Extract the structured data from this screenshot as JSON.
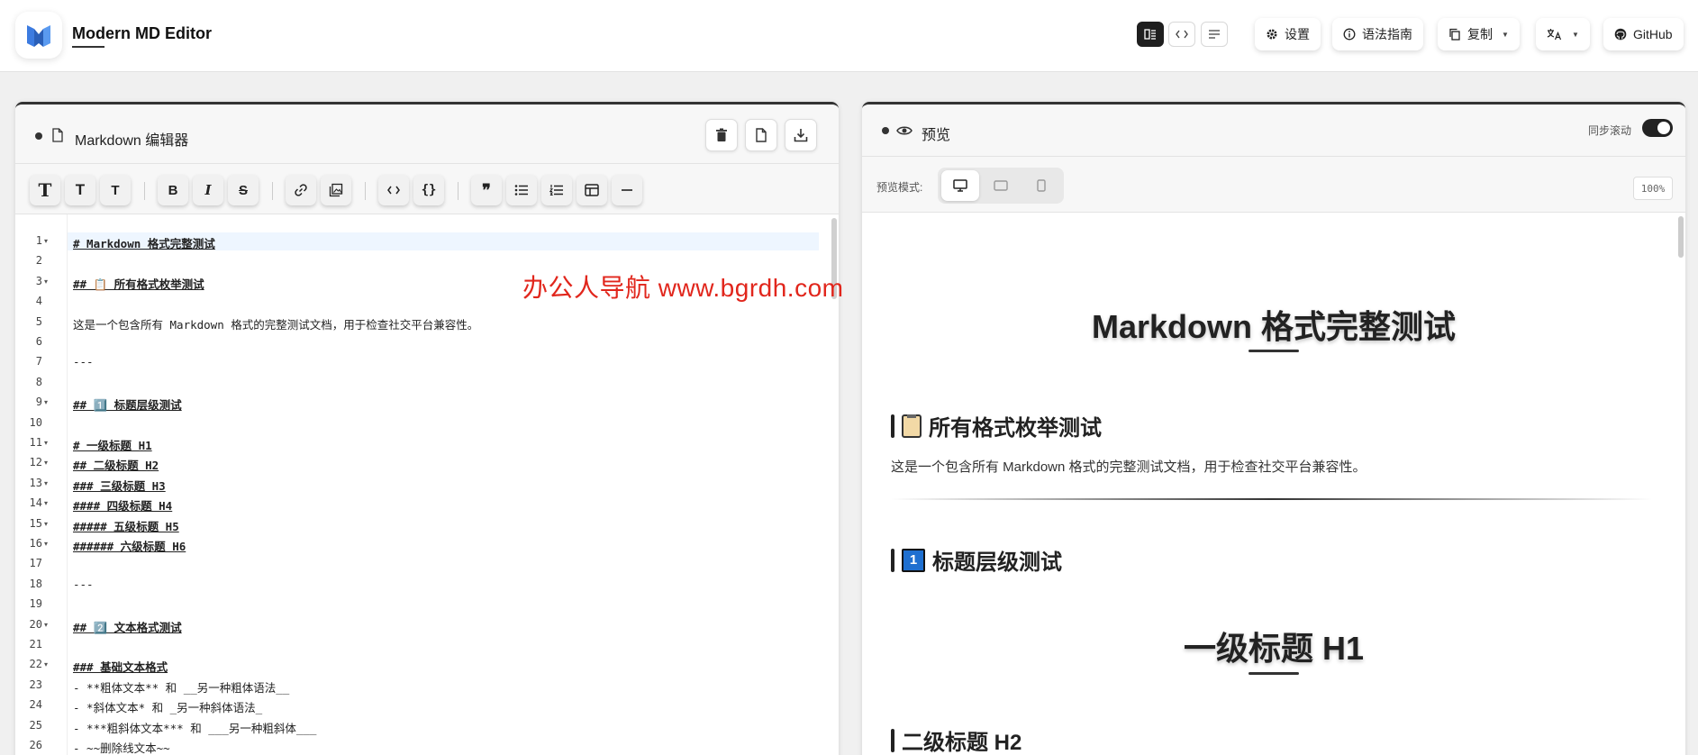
{
  "header": {
    "title": "Modern MD Editor",
    "settings_label": "设置",
    "guide_label": "语法指南",
    "copy_label": "复制",
    "github_label": "GitHub",
    "accent": "#1f1f1f"
  },
  "editor": {
    "title": "Markdown 编辑器",
    "lines": [
      {
        "n": "1",
        "fold": true,
        "text": "# Markdown 格式完整测试",
        "heading": true
      },
      {
        "n": "2",
        "fold": false,
        "text": "",
        "heading": false
      },
      {
        "n": "3",
        "fold": true,
        "text": "## 📋 所有格式枚举测试",
        "heading": true
      },
      {
        "n": "4",
        "fold": false,
        "text": "",
        "heading": false
      },
      {
        "n": "5",
        "fold": false,
        "text": "这是一个包含所有 Markdown 格式的完整测试文档，用于检查社交平台兼容性。",
        "heading": false
      },
      {
        "n": "6",
        "fold": false,
        "text": "",
        "heading": false
      },
      {
        "n": "7",
        "fold": false,
        "text": "---",
        "heading": false
      },
      {
        "n": "8",
        "fold": false,
        "text": "",
        "heading": false
      },
      {
        "n": "9",
        "fold": true,
        "text": "## 1️⃣ 标题层级测试",
        "heading": true
      },
      {
        "n": "10",
        "fold": false,
        "text": "",
        "heading": false
      },
      {
        "n": "11",
        "fold": true,
        "text": "# 一级标题 H1",
        "heading": true
      },
      {
        "n": "12",
        "fold": true,
        "text": "## 二级标题 H2",
        "heading": true
      },
      {
        "n": "13",
        "fold": true,
        "text": "### 三级标题 H3",
        "heading": true
      },
      {
        "n": "14",
        "fold": true,
        "text": "#### 四级标题 H4",
        "heading": true
      },
      {
        "n": "15",
        "fold": true,
        "text": "##### 五级标题 H5",
        "heading": true
      },
      {
        "n": "16",
        "fold": true,
        "text": "###### 六级标题 H6",
        "heading": true
      },
      {
        "n": "17",
        "fold": false,
        "text": "",
        "heading": false
      },
      {
        "n": "18",
        "fold": false,
        "text": "---",
        "heading": false
      },
      {
        "n": "19",
        "fold": false,
        "text": "",
        "heading": false
      },
      {
        "n": "20",
        "fold": true,
        "text": "## 2️⃣ 文本格式测试",
        "heading": true
      },
      {
        "n": "21",
        "fold": false,
        "text": "",
        "heading": false
      },
      {
        "n": "22",
        "fold": true,
        "text": "### 基础文本格式",
        "heading": true
      },
      {
        "n": "23",
        "fold": false,
        "text": "- **粗体文本** 和 __另一种粗体语法__",
        "heading": false
      },
      {
        "n": "24",
        "fold": false,
        "text": "- *斜体文本* 和 _另一种斜体语法_",
        "heading": false
      },
      {
        "n": "25",
        "fold": false,
        "text": "- ***粗斜体文本*** 和 ___另一种粗斜体___",
        "heading": false
      },
      {
        "n": "26",
        "fold": false,
        "text": "- ~~删除线文本~~",
        "heading": false
      }
    ]
  },
  "preview": {
    "title": "预览",
    "sync_label": "同步滚动",
    "mode_label": "预览模式:",
    "zoom": "100%",
    "h1": "Markdown 格式完整测试",
    "h2_a": "所有格式枚举测试",
    "para": "这是一个包含所有 Markdown 格式的完整测试文档，用于检查社交平台兼容性。",
    "h2_b": "标题层级测试",
    "h2_b_num": "1",
    "h1_b": "一级标题 H1",
    "h2_c": "二级标题 H2"
  },
  "watermark": "办公人导航   www.bgrdh.com"
}
